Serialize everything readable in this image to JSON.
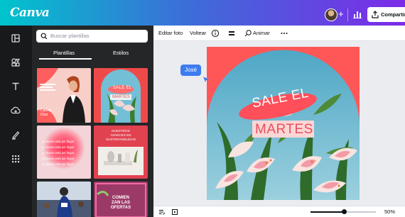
{
  "header": {
    "logo_text": "Canva",
    "share_label": "Compartir"
  },
  "search": {
    "placeholder": "Buscar plantillas"
  },
  "panel": {
    "tabs": [
      {
        "label": "Plantillas",
        "active": true
      },
      {
        "label": "Estilos",
        "active": false
      }
    ],
    "thumbnails": [
      {
        "lines": [
          "Camila",
          "Díaz"
        ]
      },
      {
        "lines": [
          "SALE EL",
          "MARTES"
        ]
      },
      {
        "lines": [
          "Lo bueno está por llegar",
          "Lo bueno está por llegar",
          "Lo bueno está por llegar",
          "Lo bueno está por llegar",
          "Lo bueno está por llegar"
        ]
      },
      {
        "lines": [
          "NUESTROS",
          "AVANCES EN",
          "SUSTENTABILIDAD"
        ]
      },
      {
        "lines": []
      },
      {
        "lines": [
          "COMIEN",
          "ZAN LAS",
          "OFERTAS"
        ]
      }
    ]
  },
  "toolbar": {
    "edit_photo": "Editar foto",
    "flip": "Voltear",
    "animate": "Animar"
  },
  "design": {
    "headline_top": "SALE EL",
    "headline_bottom": "MARTES"
  },
  "collaborator": {
    "name": "José"
  },
  "zoom": {
    "label": "50%",
    "value": 50
  },
  "colors": {
    "accent_pink": "#ff5757",
    "sky": "#6fb8cf",
    "collab_blue": "#3d7cf0"
  }
}
